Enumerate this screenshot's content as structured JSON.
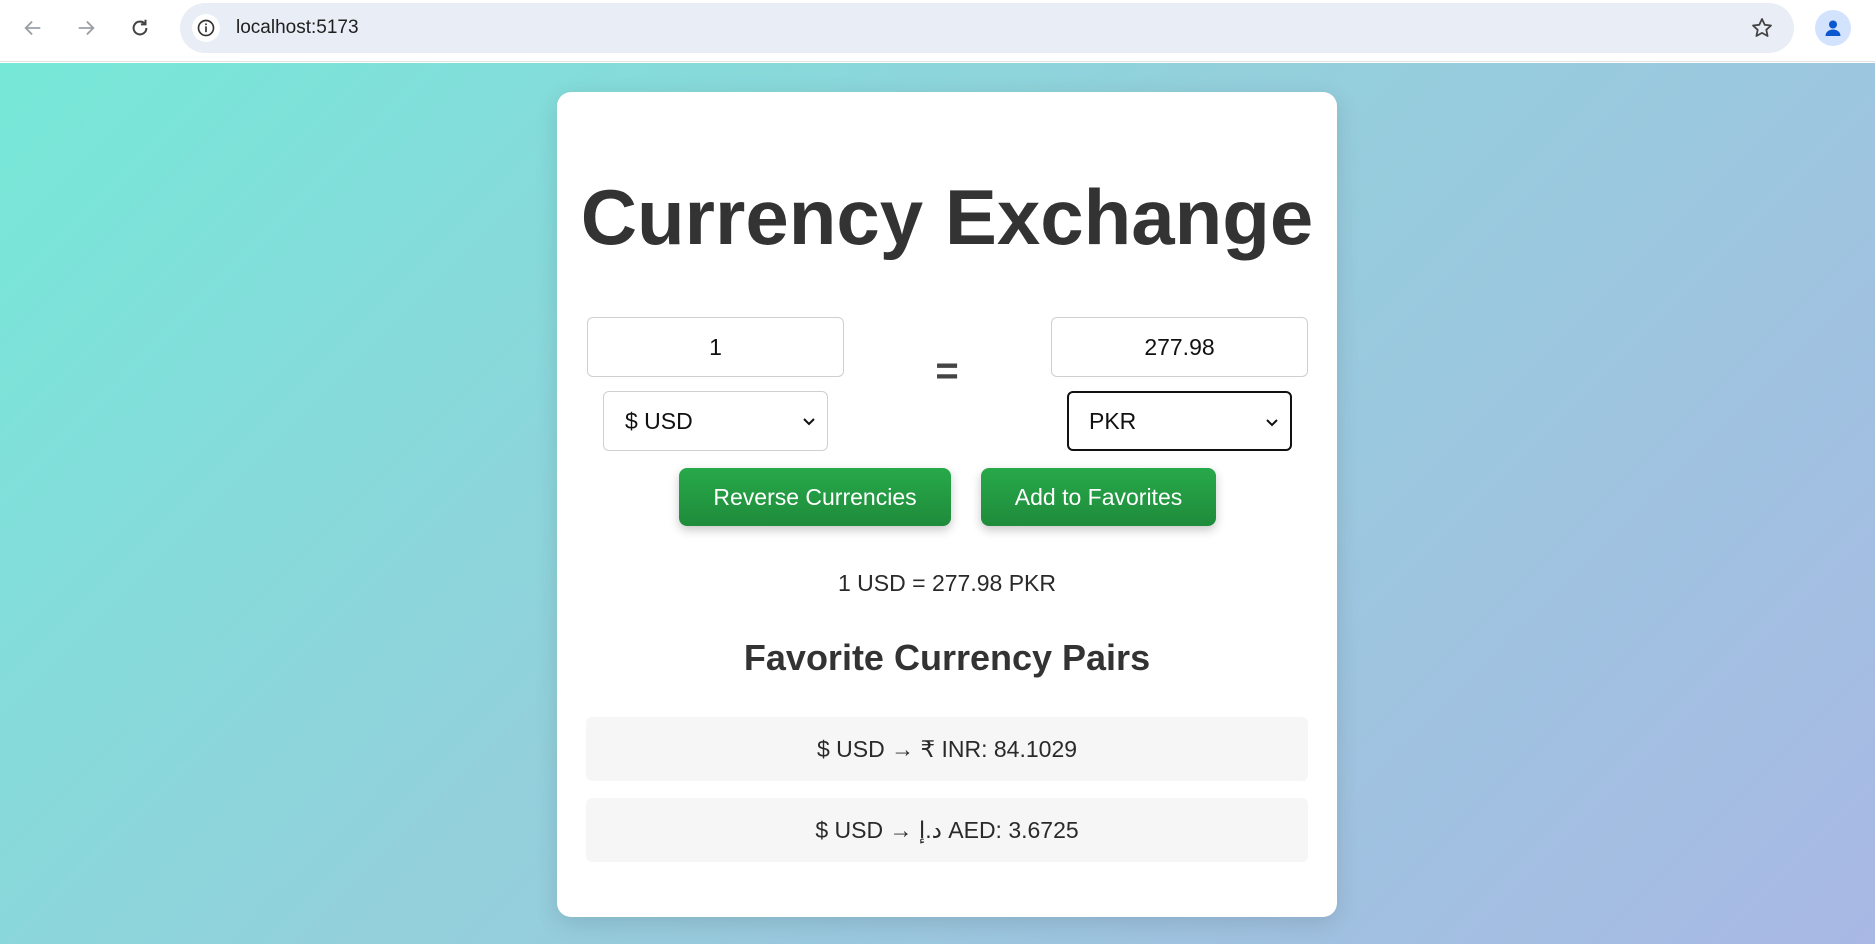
{
  "browser": {
    "url": "localhost:5173"
  },
  "app": {
    "title": "Currency Exchange",
    "from_amount": "1",
    "to_amount": "277.98",
    "from_currency": "$ USD",
    "to_currency": "PKR",
    "equals_sign": "=",
    "reverse_label": "Reverse Currencies",
    "favorite_label": "Add to Favorites",
    "result_text": "1 USD = 277.98 PKR",
    "favorites_title": "Favorite Currency Pairs",
    "favorites": [
      {
        "text": "$ USD → ₹ INR: 84.1029"
      },
      {
        "text": "$ USD → د.إ AED: 3.6725"
      }
    ]
  },
  "colors": {
    "button_green": "#28a745",
    "title_text": "#333333",
    "gradient_start": "#76e8d8",
    "gradient_end": "#a9b8e4"
  }
}
